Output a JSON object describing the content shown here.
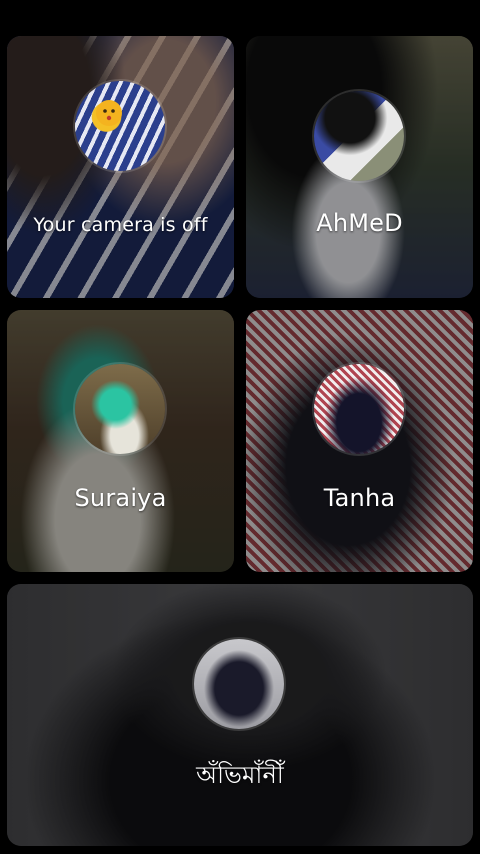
{
  "tiles": [
    {
      "id": "self",
      "label": "Your camera is off"
    },
    {
      "id": "ahmed",
      "label": "AhMeD"
    },
    {
      "id": "suraiya",
      "label": "Suraiya"
    },
    {
      "id": "tanha",
      "label": "Tanha"
    },
    {
      "id": "bottom",
      "label": "অঁভিমাঁনীঁ"
    }
  ],
  "colors": {
    "background": "#000000",
    "tile_dim_overlay": "rgba(0,0,0,0.38)",
    "text": "#ffffff"
  }
}
